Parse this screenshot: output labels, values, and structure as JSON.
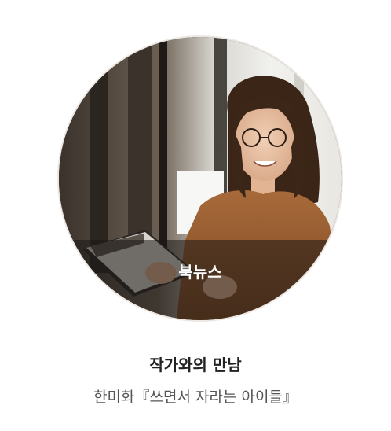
{
  "card": {
    "badge_label": "북뉴스",
    "title": "작가와의 만남",
    "subtitle": "한미화『쓰면서 자라는 아이들』"
  },
  "colors": {
    "badge_bg": "#1c1816",
    "title_text": "#222222",
    "subtitle_text": "#555555"
  }
}
